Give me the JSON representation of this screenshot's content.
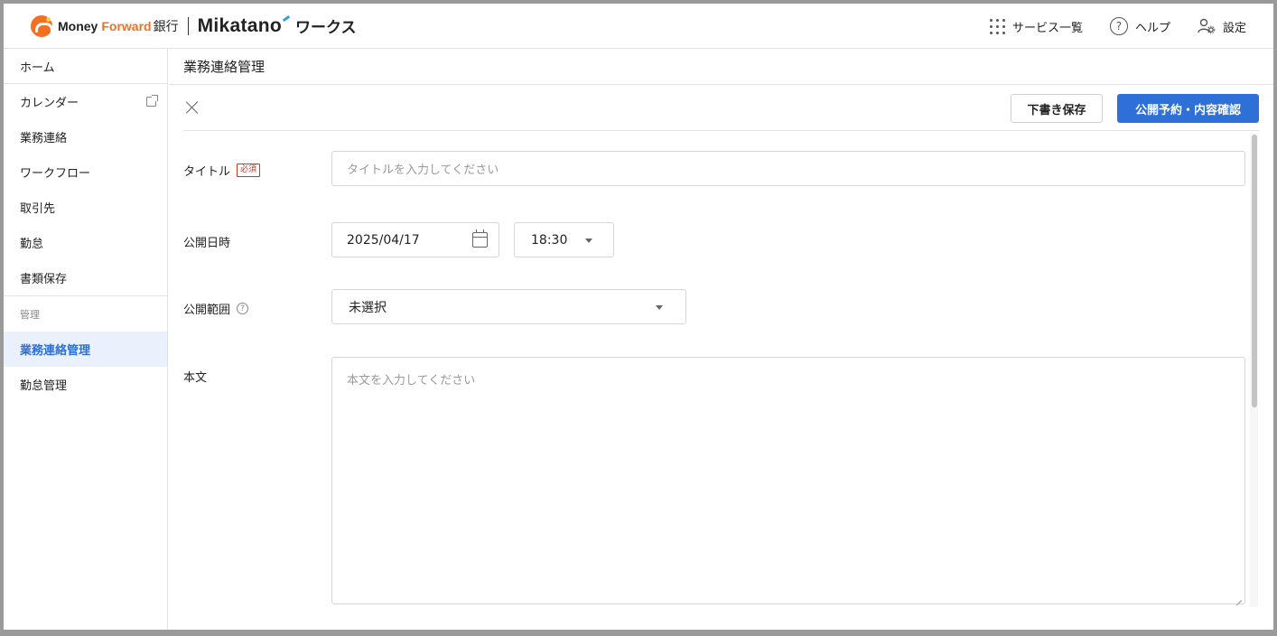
{
  "header": {
    "brand_money": "Money",
    "brand_forward": "Forward",
    "brand_bank": "銀行",
    "brand_mikatano": "Mikatano",
    "brand_works": "ワークス",
    "services_label": "サービス一覧",
    "help_label": "ヘルプ",
    "help_glyph": "?",
    "settings_label": "設定"
  },
  "sidebar": {
    "items_top": [
      {
        "label": "ホーム"
      },
      {
        "label": "カレンダー"
      },
      {
        "label": "業務連絡"
      },
      {
        "label": "ワークフロー"
      },
      {
        "label": "取引先"
      },
      {
        "label": "勤怠"
      },
      {
        "label": "書類保存"
      }
    ],
    "section_label": "管理",
    "items_admin": [
      {
        "label": "業務連絡管理",
        "active": true
      },
      {
        "label": "勤怠管理"
      }
    ]
  },
  "main": {
    "page_title": "業務連絡管理",
    "draft_button": "下書き保存",
    "publish_button": "公開予約・内容確認",
    "form": {
      "title_label": "タイトル",
      "required_badge": "必須",
      "title_placeholder": "タイトルを入力してください",
      "publish_datetime_label": "公開日時",
      "publish_date": "2025/04/17",
      "publish_time": "18:30",
      "scope_label": "公開範囲",
      "scope_help_glyph": "?",
      "scope_value": "未選択",
      "body_label": "本文",
      "body_placeholder": "本文を入力してください"
    }
  },
  "colors": {
    "accent": "#2e6fd8",
    "active_bg": "#eaf1fd",
    "brand_orange": "#f36f21",
    "required": "#d93025"
  }
}
